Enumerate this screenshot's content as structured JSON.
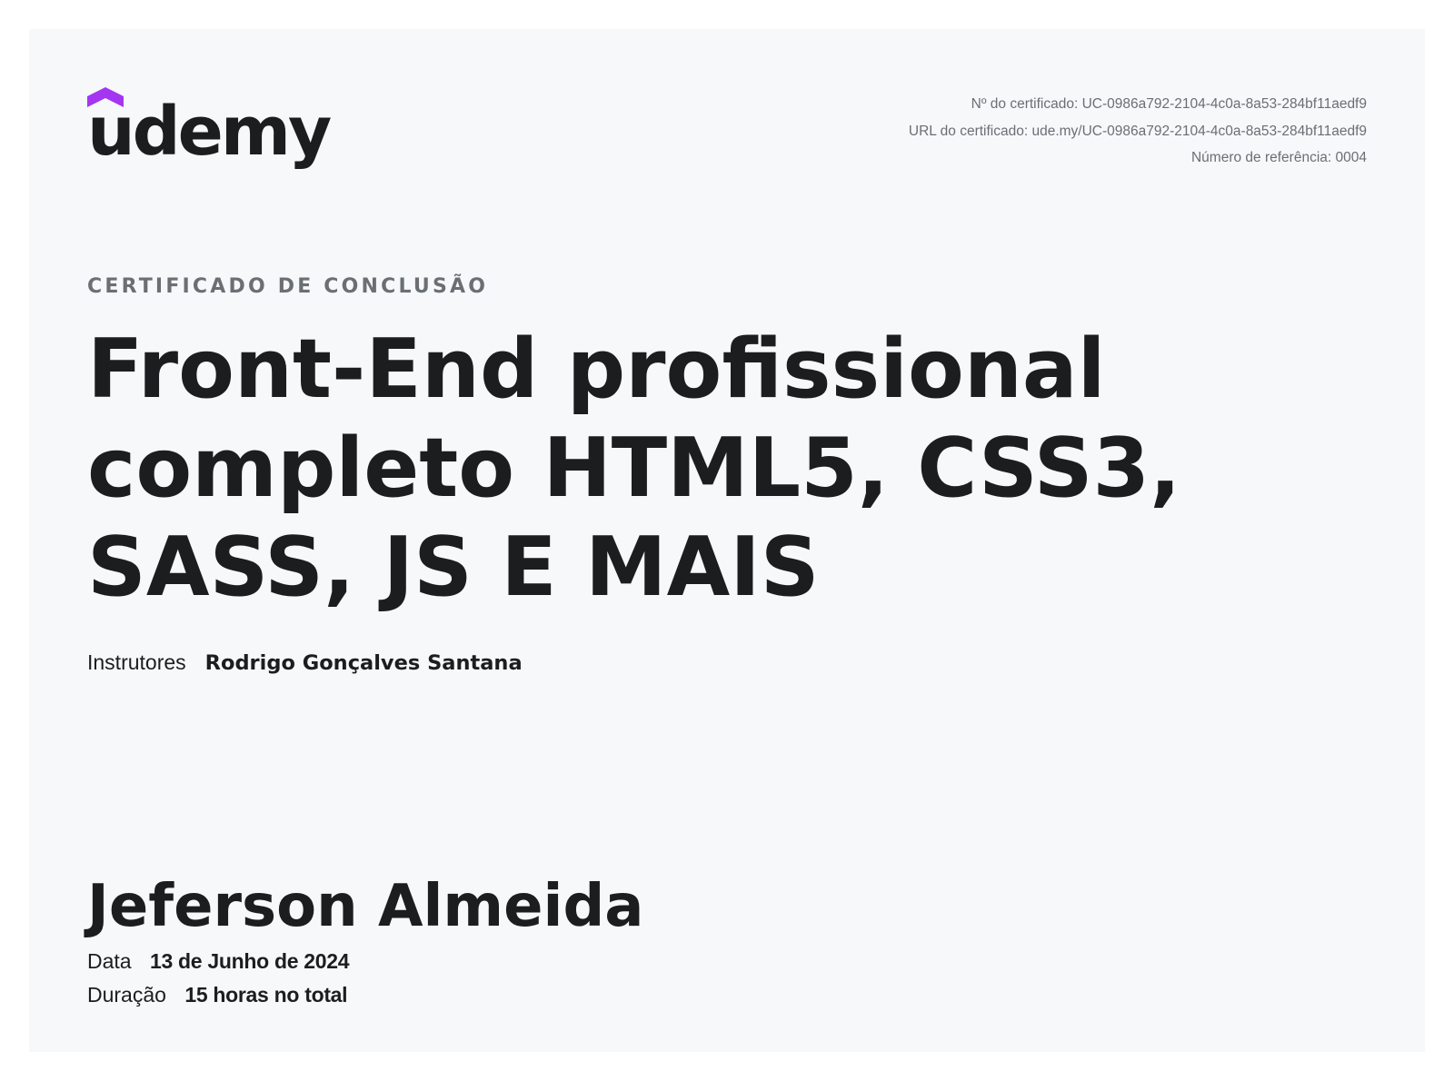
{
  "brand": {
    "name": "udemy",
    "accent_color": "#a435f0",
    "text_color": "#1c1d1f"
  },
  "certificate_meta": {
    "number": "Nº do certificado: UC-0986a792-2104-4c0a-8a53-284bf11aedf9",
    "url": "URL do certificado: ude.my/UC-0986a792-2104-4c0a-8a53-284bf11aedf9",
    "reference": "Número de referência: 0004"
  },
  "kicker": "CERTIFICADO DE CONCLUSÃO",
  "course": {
    "title": "Front-End profissional completo HTML5, CSS3, SASS, JS E MAIS"
  },
  "instructors": {
    "label": "Instrutores",
    "name": "Rodrigo Gonçalves Santana"
  },
  "student": {
    "name": "Jeferson Almeida"
  },
  "details": {
    "date_label": "Data",
    "date_value": "13 de Junho de 2024",
    "duration_label": "Duração",
    "duration_value": "15 horas no total"
  },
  "colors": {
    "background": "#f7f8fa",
    "muted_text": "#6a6f73"
  }
}
